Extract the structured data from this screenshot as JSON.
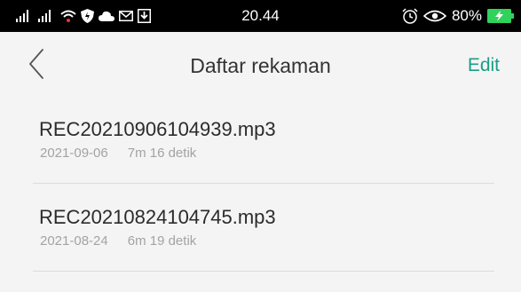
{
  "status_bar": {
    "time": "20.44",
    "battery_percent": "80%",
    "left_icons": [
      "signal-bars-icon",
      "signal-bars-icon",
      "wifi-icon",
      "shield-icon",
      "cloud-icon",
      "mail-icon",
      "download-icon"
    ],
    "right_icons": [
      "alarm-icon",
      "eye-icon",
      "battery-charging-icon"
    ],
    "battery_color": "#2fd25a"
  },
  "header": {
    "title": "Daftar rekaman",
    "edit_label": "Edit",
    "accent_color": "#1a9e87"
  },
  "recordings": [
    {
      "name": "REC20210906104939.mp3",
      "date": "2021-09-06",
      "duration": "7m 16 detik"
    },
    {
      "name": "REC20210824104745.mp3",
      "date": "2021-08-24",
      "duration": "6m 19 detik"
    }
  ]
}
